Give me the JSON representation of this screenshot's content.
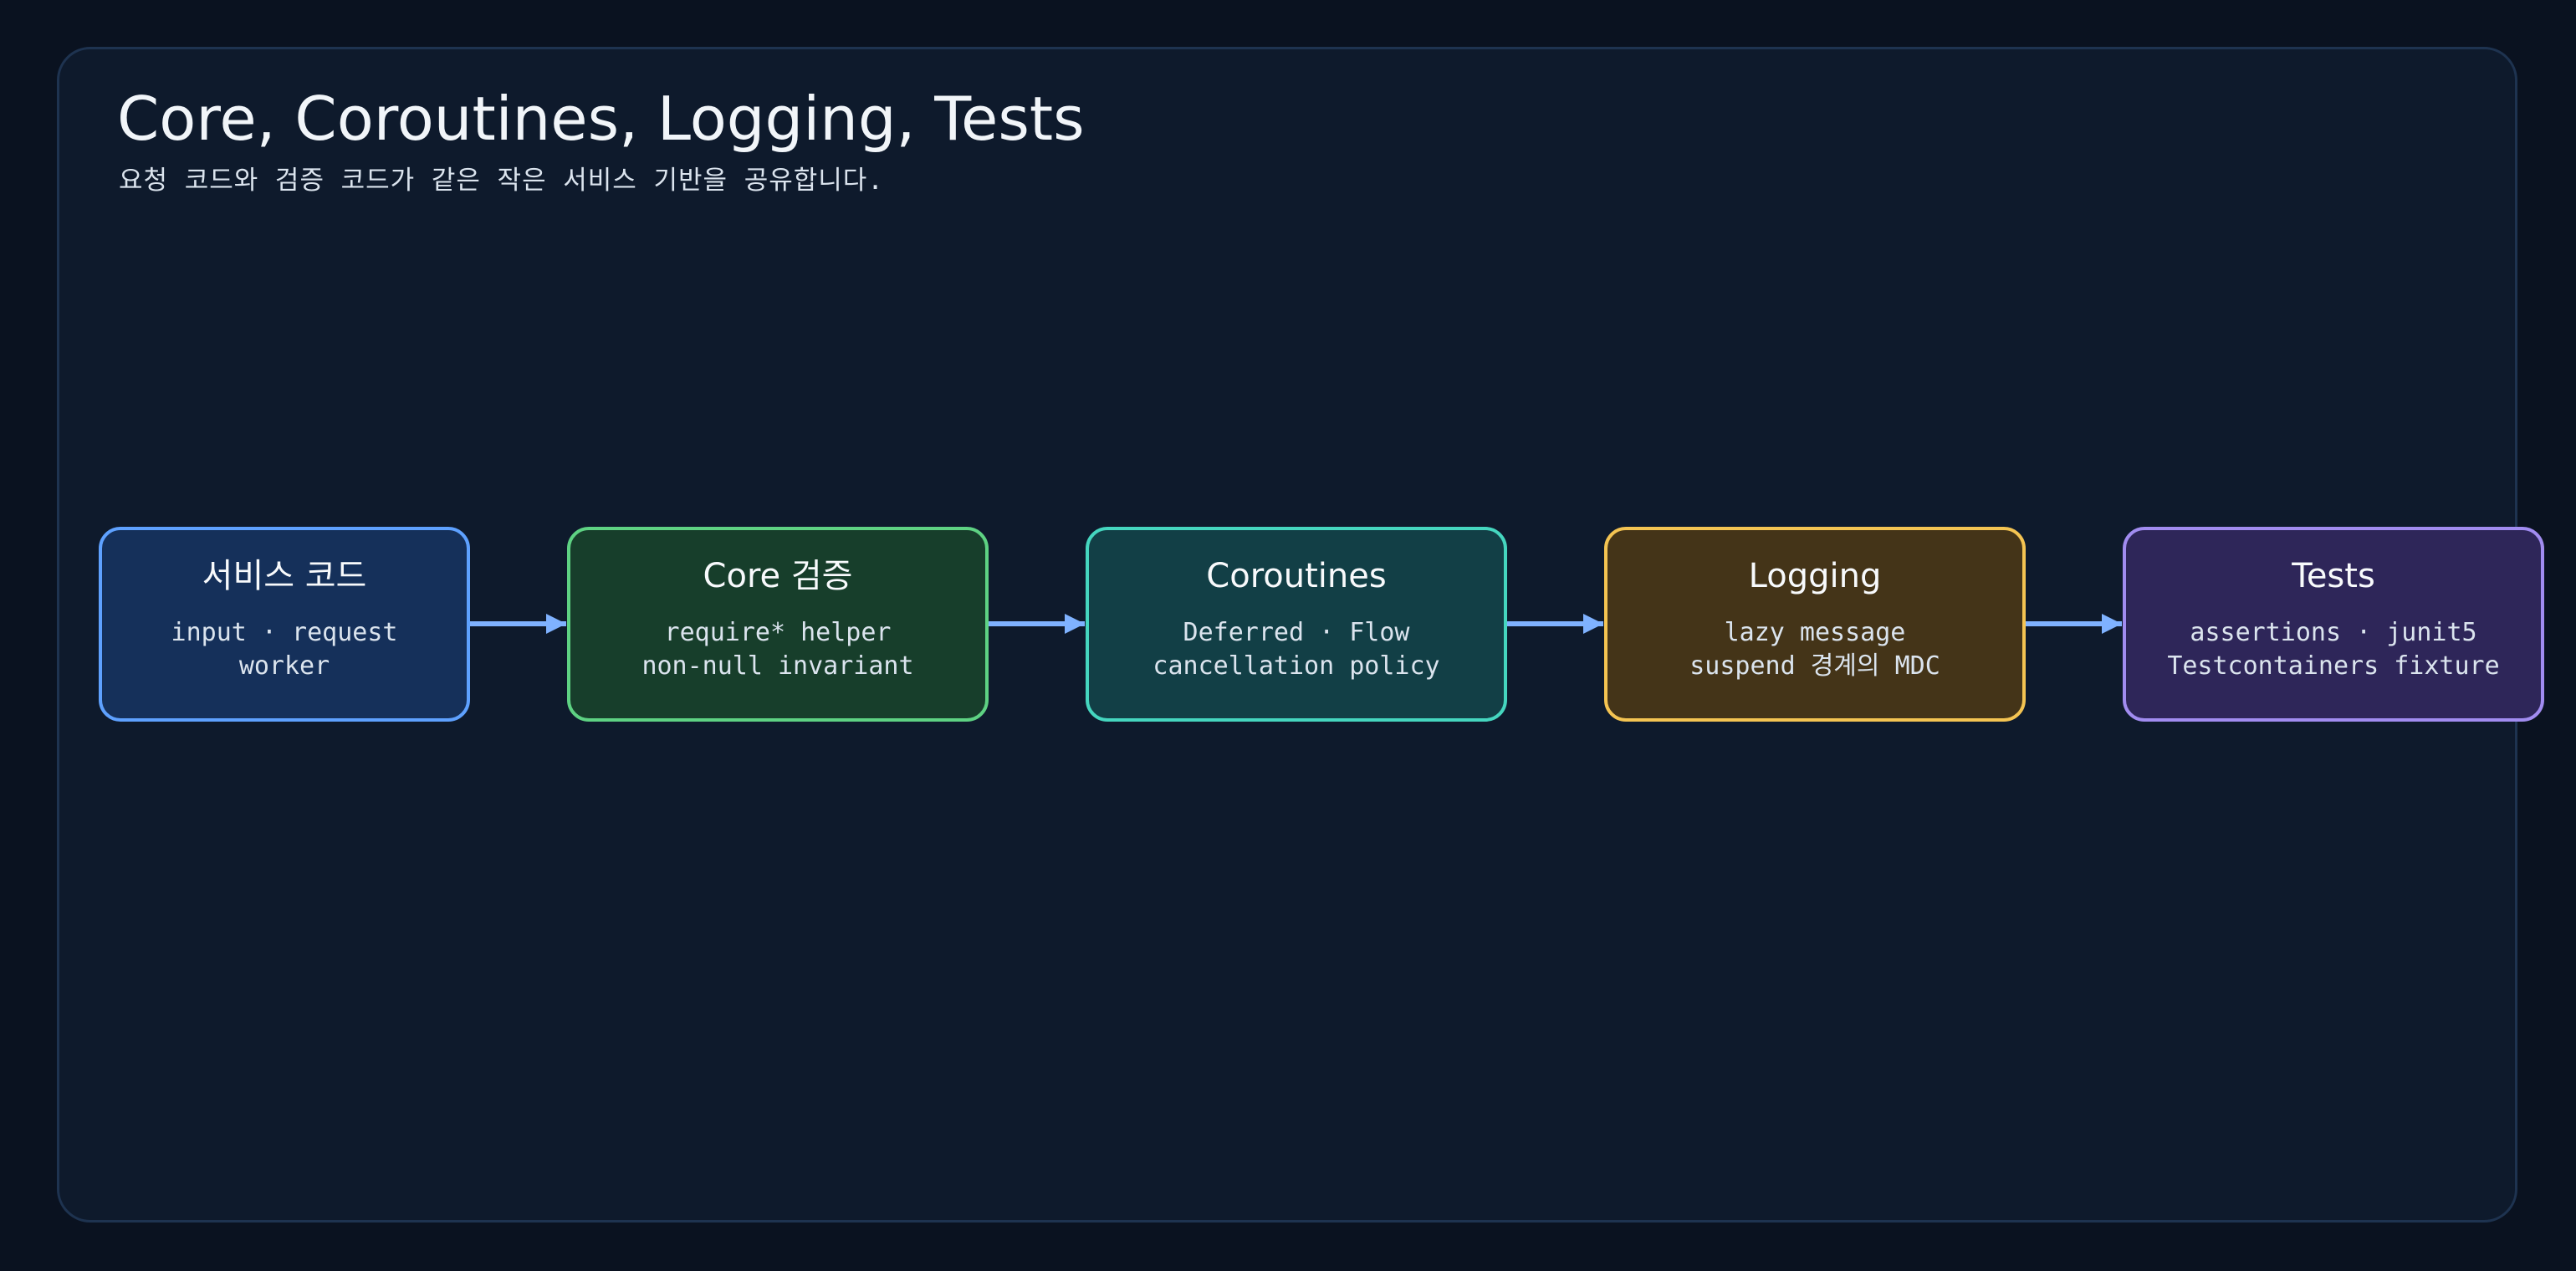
{
  "header": {
    "title": "Core, Coroutines, Logging, Tests",
    "subtitle": "요청 코드와 검증 코드가 같은 작은 서비스 기반을 공유합니다."
  },
  "nodes": [
    {
      "id": "service",
      "title": "서비스 코드",
      "lines": [
        "input · request",
        "worker"
      ],
      "fill": "#15305a",
      "border": "#5ea1ff"
    },
    {
      "id": "core",
      "title": "Core 검증",
      "lines": [
        "require* helper",
        "non-null invariant"
      ],
      "fill": "#173e2b",
      "border": "#5ed283"
    },
    {
      "id": "coroutines",
      "title": "Coroutines",
      "lines": [
        "Deferred · Flow",
        "cancellation policy"
      ],
      "fill": "#123f46",
      "border": "#45d6bf"
    },
    {
      "id": "logging",
      "title": "Logging",
      "lines": [
        "lazy message",
        "suspend 경계의 MDC"
      ],
      "fill": "#443418",
      "border": "#f4c452"
    },
    {
      "id": "tests",
      "title": "Tests",
      "lines": [
        "assertions · junit5",
        "Testcontainers fixture"
      ],
      "fill": "#2e2659",
      "border": "#a18cf0"
    }
  ],
  "edges": [
    {
      "from": "service",
      "to": "core"
    },
    {
      "from": "core",
      "to": "coroutines"
    },
    {
      "from": "coroutines",
      "to": "logging"
    },
    {
      "from": "logging",
      "to": "tests"
    }
  ],
  "colors": {
    "background": "#0a1220",
    "panel": "#0e1a2c",
    "panel_border": "#1e3350",
    "arrow": "#7fb2ff"
  }
}
